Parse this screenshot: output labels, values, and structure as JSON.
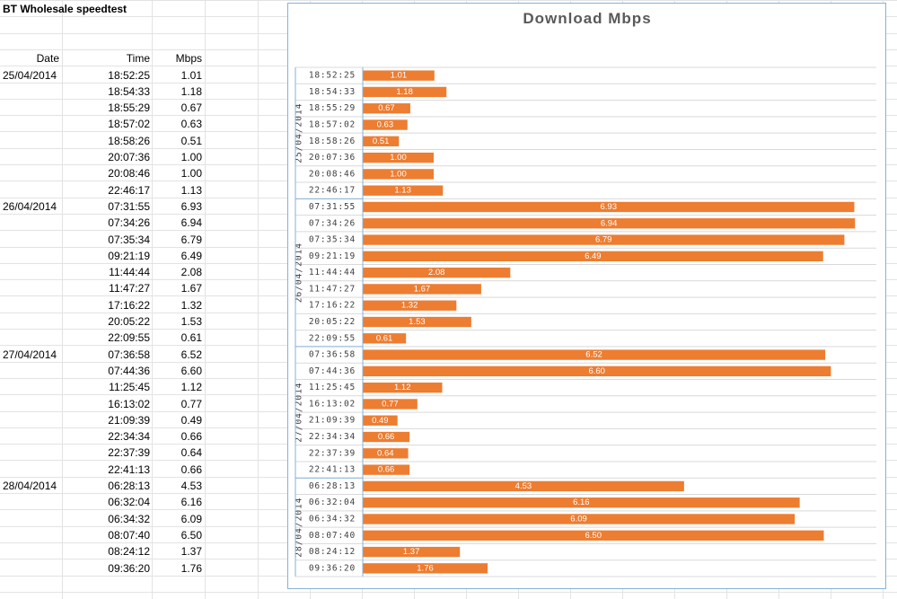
{
  "sheet": {
    "title": "BT Wholesale speedtest",
    "headers": {
      "date": "Date",
      "time": "Time",
      "mbps": "Mbps"
    },
    "groups": [
      {
        "date": "25/04/2014",
        "rows": [
          {
            "time": "18:52:25",
            "mbps": "1.01"
          },
          {
            "time": "18:54:33",
            "mbps": "1.18"
          },
          {
            "time": "18:55:29",
            "mbps": "0.67"
          },
          {
            "time": "18:57:02",
            "mbps": "0.63"
          },
          {
            "time": "18:58:26",
            "mbps": "0.51"
          },
          {
            "time": "20:07:36",
            "mbps": "1.00"
          },
          {
            "time": "20:08:46",
            "mbps": "1.00"
          },
          {
            "time": "22:46:17",
            "mbps": "1.13"
          }
        ]
      },
      {
        "date": "26/04/2014",
        "rows": [
          {
            "time": "07:31:55",
            "mbps": "6.93"
          },
          {
            "time": "07:34:26",
            "mbps": "6.94"
          },
          {
            "time": "07:35:34",
            "mbps": "6.79"
          },
          {
            "time": "09:21:19",
            "mbps": "6.49"
          },
          {
            "time": "11:44:44",
            "mbps": "2.08"
          },
          {
            "time": "11:47:27",
            "mbps": "1.67"
          },
          {
            "time": "17:16:22",
            "mbps": "1.32"
          },
          {
            "time": "20:05:22",
            "mbps": "1.53"
          },
          {
            "time": "22:09:55",
            "mbps": "0.61"
          }
        ]
      },
      {
        "date": "27/04/2014",
        "rows": [
          {
            "time": "07:36:58",
            "mbps": "6.52"
          },
          {
            "time": "07:44:36",
            "mbps": "6.60"
          },
          {
            "time": "11:25:45",
            "mbps": "1.12"
          },
          {
            "time": "16:13:02",
            "mbps": "0.77"
          },
          {
            "time": "21:09:39",
            "mbps": "0.49"
          },
          {
            "time": "22:34:34",
            "mbps": "0.66"
          },
          {
            "time": "22:37:39",
            "mbps": "0.64"
          },
          {
            "time": "22:41:13",
            "mbps": "0.66"
          }
        ]
      },
      {
        "date": "28/04/2014",
        "rows": [
          {
            "time": "06:28:13",
            "mbps": "4.53"
          },
          {
            "time": "06:32:04",
            "mbps": "6.16"
          },
          {
            "time": "06:34:32",
            "mbps": "6.09"
          },
          {
            "time": "08:07:40",
            "mbps": "6.50"
          },
          {
            "time": "08:24:12",
            "mbps": "1.37"
          },
          {
            "time": "09:36:20",
            "mbps": "1.76"
          }
        ]
      }
    ]
  },
  "colors": {
    "bar": "#ed7d31",
    "gridline": "#d9d9d9",
    "chart_border": "#86b2d8",
    "axis_line": "#86b2d8",
    "title_text": "#595959",
    "label_text": "#404040",
    "data_label": "#ffffff"
  },
  "chart_data": {
    "type": "bar",
    "orientation": "horizontal",
    "title": "Download Mbps",
    "xlim": [
      0,
      7.5
    ],
    "grid": true,
    "legend": "none",
    "data_labels": "inside-bar",
    "groups": [
      {
        "label": "25/04/2014",
        "categories": [
          "18:52:25",
          "18:54:33",
          "18:55:29",
          "18:57:02",
          "18:58:26",
          "20:07:36",
          "20:08:46",
          "22:46:17"
        ],
        "values": [
          1.01,
          1.18,
          0.67,
          0.63,
          0.51,
          1.0,
          1.0,
          1.13
        ]
      },
      {
        "label": "26/04/2014",
        "categories": [
          "07:31:55",
          "07:34:26",
          "07:35:34",
          "09:21:19",
          "11:44:44",
          "11:47:27",
          "17:16:22",
          "20:05:22",
          "22:09:55"
        ],
        "values": [
          6.93,
          6.94,
          6.79,
          6.49,
          2.08,
          1.67,
          1.32,
          1.53,
          0.61
        ]
      },
      {
        "label": "27/04/2014",
        "categories": [
          "07:36:58",
          "07:44:36",
          "11:25:45",
          "16:13:02",
          "21:09:39",
          "22:34:34",
          "22:37:39",
          "22:41:13"
        ],
        "values": [
          6.52,
          6.6,
          1.12,
          0.77,
          0.49,
          0.66,
          0.64,
          0.66
        ]
      },
      {
        "label": "28/04/2014",
        "categories": [
          "06:28:13",
          "06:32:04",
          "06:34:32",
          "08:07:40",
          "08:24:12",
          "09:36:20"
        ],
        "values": [
          4.53,
          6.16,
          6.09,
          6.5,
          1.37,
          1.76
        ]
      }
    ]
  }
}
